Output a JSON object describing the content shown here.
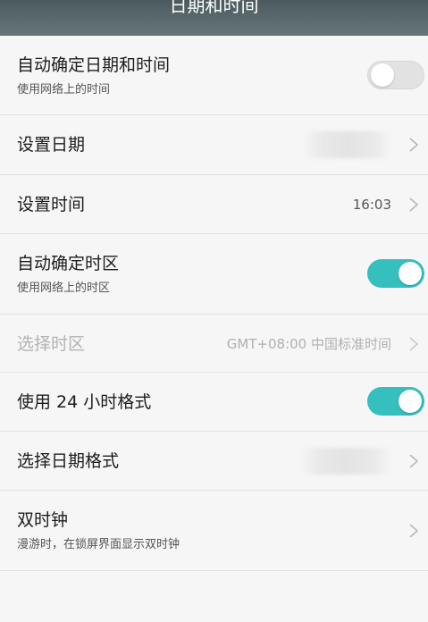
{
  "header": {
    "title": "日期和时间"
  },
  "settings": {
    "auto_datetime": {
      "label": "自动确定日期和时间",
      "summary": "使用网络上的时间",
      "enabled": false
    },
    "set_date": {
      "label": "设置日期",
      "value": ""
    },
    "set_time": {
      "label": "设置时间",
      "value": "16:03"
    },
    "auto_timezone": {
      "label": "自动确定时区",
      "summary": "使用网络上的时区",
      "enabled": true
    },
    "select_timezone": {
      "label": "选择时区",
      "value": "GMT+08:00 中国标准时间",
      "disabled": true
    },
    "use_24h": {
      "label": "使用 24 小时格式",
      "enabled": true
    },
    "date_format": {
      "label": "选择日期格式",
      "value": ""
    },
    "dual_clock": {
      "label": "双时钟",
      "summary": "漫游时，在锁屏界面显示双时钟"
    }
  },
  "colors": {
    "accent": "#35bfbf",
    "header_bg": "#5b6b6f",
    "page_bg": "#f6f6f6",
    "divider": "#e1e1e1"
  },
  "icons": {
    "row_chevron": "chevron-right-icon"
  }
}
